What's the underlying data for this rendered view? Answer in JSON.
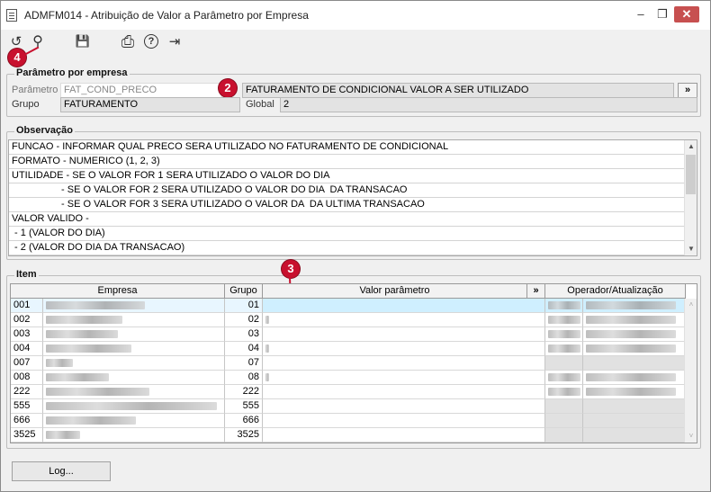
{
  "window": {
    "title": "ADMFM014 - Atribuição de Valor a Parâmetro por Empresa",
    "minimize": "–",
    "maximize": "❐",
    "close": "✕"
  },
  "toolbar": {
    "undo_icon": "↺",
    "search_icon": "⚲",
    "save_icon": "💾",
    "print_icon": "⎙",
    "help_icon": "?",
    "exit_icon": "⇥"
  },
  "badges": {
    "b4": "4",
    "b2": "2",
    "b3": "3"
  },
  "param_section": {
    "legend": "Parâmetro por empresa",
    "parametro_label": "Parâmetro",
    "parametro_value": "FAT_COND_PRECO",
    "descricao_value": "FATURAMENTO DE CONDICIONAL VALOR A SER UTILIZADO",
    "more_button": "»",
    "grupo_label": "Grupo",
    "grupo_value": "FATURAMENTO",
    "global_label": "Global",
    "global_value": "2"
  },
  "obs_section": {
    "legend": "Observação",
    "lines": [
      "FUNCAO - INFORMAR QUAL PRECO SERA UTILIZADO NO FATURAMENTO DE CONDICIONAL",
      "FORMATO - NUMERICO (1, 2, 3)",
      "UTILIDADE - SE O VALOR FOR 1 SERA UTILIZADO O VALOR DO DIA",
      "                  - SE O VALOR FOR 2 SERA UTILIZADO O VALOR DO DIA  DA TRANSACAO",
      "                  - SE O VALOR FOR 3 SERA UTILIZADO O VALOR DA  DA ULTIMA TRANSACAO",
      "VALOR VALIDO -",
      " - 1 (VALOR DO DIA)",
      " - 2 (VALOR DO DIA DA TRANSACAO)"
    ]
  },
  "item_section": {
    "legend": "Item",
    "headers": {
      "empresa": "Empresa",
      "grupo": "Grupo",
      "valor": "Valor parâmetro",
      "more": "»",
      "operador": "Operador/Atualização"
    },
    "rows": [
      {
        "code": "001",
        "grupo": "01",
        "empresa_w": 110,
        "valor_mark": "",
        "op": true
      },
      {
        "code": "002",
        "grupo": "02",
        "empresa_w": 85,
        "valor_mark": "1",
        "op": true
      },
      {
        "code": "003",
        "grupo": "03",
        "empresa_w": 80,
        "valor_mark": "",
        "op": true
      },
      {
        "code": "004",
        "grupo": "04",
        "empresa_w": 95,
        "valor_mark": "1",
        "op": true
      },
      {
        "code": "007",
        "grupo": "07",
        "empresa_w": 30,
        "valor_mark": "",
        "op": false
      },
      {
        "code": "008",
        "grupo": "08",
        "empresa_w": 70,
        "valor_mark": "1",
        "op": true
      },
      {
        "code": "222",
        "grupo": "222",
        "empresa_w": 115,
        "valor_mark": "",
        "op": true
      },
      {
        "code": "555",
        "grupo": "555",
        "empresa_w": 190,
        "valor_mark": "",
        "op": false
      },
      {
        "code": "666",
        "grupo": "666",
        "empresa_w": 100,
        "valor_mark": "",
        "op": false
      },
      {
        "code": "3525",
        "grupo": "3525",
        "empresa_w": 38,
        "valor_mark": "",
        "op": false
      }
    ]
  },
  "footer": {
    "log_button": "Log..."
  }
}
